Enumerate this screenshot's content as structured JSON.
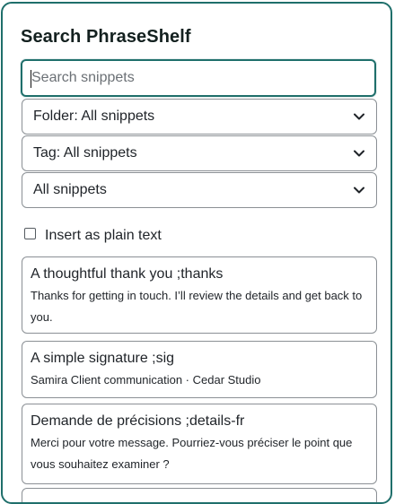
{
  "panel": {
    "title": "Search PhraseShelf",
    "accent_color": "#1f6f6b"
  },
  "search": {
    "placeholder": "Search snippets",
    "value": ""
  },
  "filters": {
    "folder": {
      "selected": "Folder: All snippets"
    },
    "tag": {
      "selected": "Tag: All snippets"
    },
    "scope": {
      "selected": "All snippets"
    }
  },
  "options": {
    "plain_text_label": "Insert as plain text",
    "plain_text_checked": false
  },
  "snippets": [
    {
      "title": "A thoughtful thank you ;thanks",
      "body": "Thanks for getting in touch. I’ll review the details and get back to you."
    },
    {
      "title": "A simple signature ;sig",
      "body": "Samira Client communication · Cedar Studio"
    },
    {
      "title": "Demande de précisions ;details-fr",
      "body": "Merci pour votre message. Pourriez-vous préciser le point que vous souhaitez examiner ?"
    }
  ],
  "icons": {
    "select_chevron": "chevron-down-icon",
    "checkbox": "checkbox-icon"
  }
}
